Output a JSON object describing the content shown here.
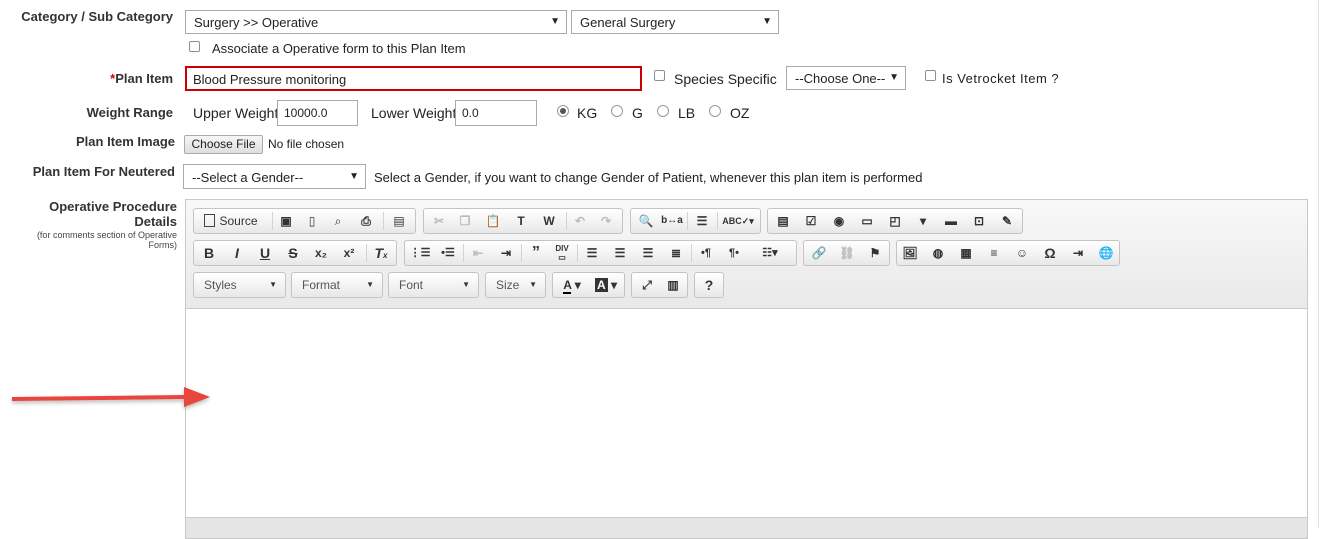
{
  "form": {
    "category_label": "Category / Sub Category",
    "category_value": "Surgery >> Operative",
    "subcategory_value": "General Surgery",
    "associate_label": "Associate a Operative form to this Plan Item",
    "plan_item_required": "*",
    "plan_item_label": "Plan Item",
    "plan_item_value": "Blood Pressure monitoring",
    "species_specific_label": "Species Specific",
    "species_select_value": "--Choose One--",
    "vetrocket_label": "Is Vetrocket Item ?",
    "weight_range_label": "Weight Range",
    "upper_weight_label": "Upper Weight",
    "upper_weight_value": "10000.0",
    "lower_weight_label": "Lower Weight",
    "lower_weight_value": "0.0",
    "units": [
      "KG",
      "G",
      "LB",
      "OZ"
    ],
    "selected_unit": "KG",
    "image_label": "Plan Item Image",
    "choose_file_label": "Choose File",
    "no_file_text": "No file chosen",
    "neutered_label": "Plan Item For Neutered",
    "gender_select_value": "--Select a Gender--",
    "gender_help": "Select a Gender, if you want to change Gender of Patient, whenever this plan item is performed",
    "procedure_label_line1": "Operative Procedure",
    "procedure_label_line2": "Details",
    "procedure_note": "(for comments section of Operative Forms)"
  },
  "editor": {
    "source_label": "Source",
    "styles_label": "Styles",
    "format_label": "Format",
    "font_label": "Font",
    "size_label": "Size",
    "help_label": "?"
  },
  "colors": {
    "arrow": "#e8453c",
    "required_border": "#cc0000"
  }
}
